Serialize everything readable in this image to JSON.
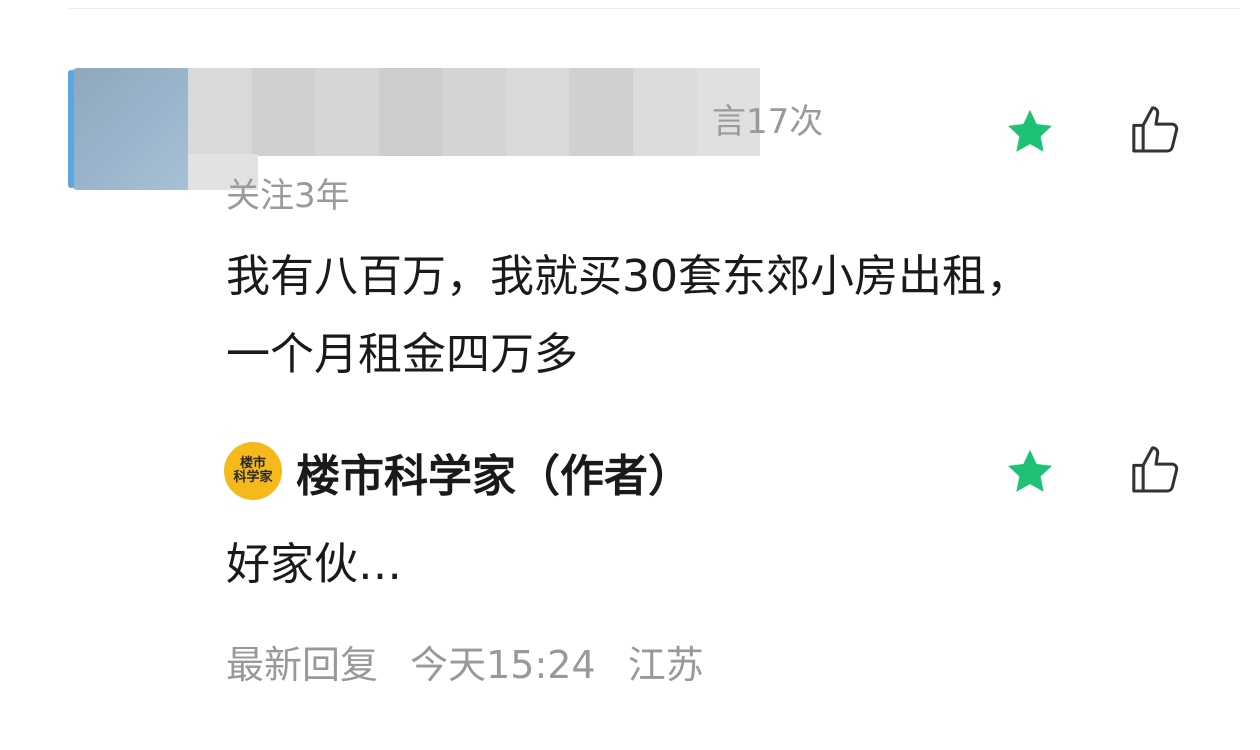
{
  "colors": {
    "star": "#1ec274",
    "meta_text": "#9a9a9a",
    "main_text": "#1a1a1a",
    "author_avatar_bg": "#f5b91b"
  },
  "comment": {
    "user_meta": "言17次",
    "follow_meta": "关注3年",
    "line1": "我有八百万，我就买30套东郊小房出租，",
    "line2": "一个月租金四万多",
    "star_icon": "star-icon",
    "like_icon": "thumbs-up-icon"
  },
  "reply": {
    "avatar_text_top": "楼市",
    "avatar_text_bottom": "科学家",
    "author_name": "楼市科学家（作者）",
    "text": "好家伙…",
    "label": "最新回复",
    "time": "今天15:24",
    "location": "江苏",
    "star_icon": "star-icon",
    "like_icon": "thumbs-up-icon"
  }
}
